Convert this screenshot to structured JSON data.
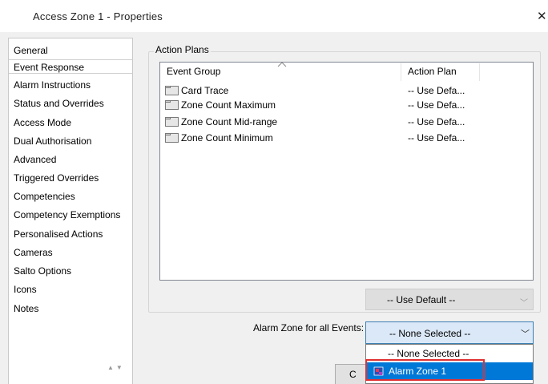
{
  "window": {
    "title": "Access Zone 1 - Properties",
    "close_glyph": "✕"
  },
  "nav": {
    "items": [
      {
        "label": "General"
      },
      {
        "label": "Event Response"
      },
      {
        "label": "Alarm Instructions"
      },
      {
        "label": "Status and Overrides"
      },
      {
        "label": "Access Mode"
      },
      {
        "label": "Dual Authorisation"
      },
      {
        "label": "Advanced"
      },
      {
        "label": "Triggered Overrides"
      },
      {
        "label": "Competencies"
      },
      {
        "label": "Competency Exemptions"
      },
      {
        "label": "Personalised Actions"
      },
      {
        "label": "Cameras"
      },
      {
        "label": "Salto Options"
      },
      {
        "label": "Icons"
      },
      {
        "label": "Notes"
      }
    ],
    "selected_label": "Event Response",
    "scroll_arrows": "▲▼"
  },
  "action_plans": {
    "legend": "Action Plans",
    "columns": {
      "event_group": "Event Group",
      "action_plan": "Action Plan"
    },
    "rows": [
      {
        "name": "Card Trace",
        "plan": "-- Use Defa..."
      },
      {
        "name": "Zone Count Maximum",
        "plan": "-- Use Defa..."
      },
      {
        "name": "Zone Count Mid-range",
        "plan": "-- Use Defa..."
      },
      {
        "name": "Zone Count Minimum",
        "plan": "-- Use Defa..."
      }
    ],
    "plan_combo": {
      "value": "-- Use Default --",
      "chevron": "﹀"
    }
  },
  "alarm_zone": {
    "label": "Alarm Zone for all Events:",
    "selected": "-- None Selected --",
    "chevron": "﹀",
    "options": [
      "-- None Selected --",
      "Alarm Zone 1"
    ]
  },
  "ok_button": {
    "label": "C"
  },
  "colors": {
    "selection": "#0078d7",
    "highlight_border": "#e03030",
    "combo_focus": "#dbe8f7"
  },
  "icons": {
    "folder": "folder-icon",
    "alarm_zone": "alarm-zone-icon"
  }
}
